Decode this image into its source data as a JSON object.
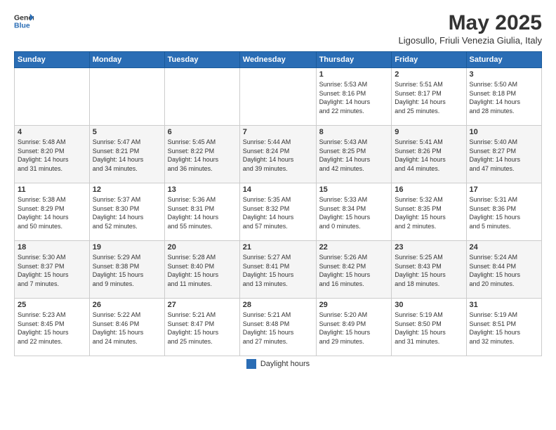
{
  "header": {
    "logo_general": "General",
    "logo_blue": "Blue",
    "month_title": "May 2025",
    "subtitle": "Ligosullo, Friuli Venezia Giulia, Italy"
  },
  "weekdays": [
    "Sunday",
    "Monday",
    "Tuesday",
    "Wednesday",
    "Thursday",
    "Friday",
    "Saturday"
  ],
  "footer": {
    "legend_label": "Daylight hours"
  },
  "weeks": [
    [
      {
        "day": "",
        "info": ""
      },
      {
        "day": "",
        "info": ""
      },
      {
        "day": "",
        "info": ""
      },
      {
        "day": "",
        "info": ""
      },
      {
        "day": "1",
        "info": "Sunrise: 5:53 AM\nSunset: 8:16 PM\nDaylight: 14 hours\nand 22 minutes."
      },
      {
        "day": "2",
        "info": "Sunrise: 5:51 AM\nSunset: 8:17 PM\nDaylight: 14 hours\nand 25 minutes."
      },
      {
        "day": "3",
        "info": "Sunrise: 5:50 AM\nSunset: 8:18 PM\nDaylight: 14 hours\nand 28 minutes."
      }
    ],
    [
      {
        "day": "4",
        "info": "Sunrise: 5:48 AM\nSunset: 8:20 PM\nDaylight: 14 hours\nand 31 minutes."
      },
      {
        "day": "5",
        "info": "Sunrise: 5:47 AM\nSunset: 8:21 PM\nDaylight: 14 hours\nand 34 minutes."
      },
      {
        "day": "6",
        "info": "Sunrise: 5:45 AM\nSunset: 8:22 PM\nDaylight: 14 hours\nand 36 minutes."
      },
      {
        "day": "7",
        "info": "Sunrise: 5:44 AM\nSunset: 8:24 PM\nDaylight: 14 hours\nand 39 minutes."
      },
      {
        "day": "8",
        "info": "Sunrise: 5:43 AM\nSunset: 8:25 PM\nDaylight: 14 hours\nand 42 minutes."
      },
      {
        "day": "9",
        "info": "Sunrise: 5:41 AM\nSunset: 8:26 PM\nDaylight: 14 hours\nand 44 minutes."
      },
      {
        "day": "10",
        "info": "Sunrise: 5:40 AM\nSunset: 8:27 PM\nDaylight: 14 hours\nand 47 minutes."
      }
    ],
    [
      {
        "day": "11",
        "info": "Sunrise: 5:38 AM\nSunset: 8:29 PM\nDaylight: 14 hours\nand 50 minutes."
      },
      {
        "day": "12",
        "info": "Sunrise: 5:37 AM\nSunset: 8:30 PM\nDaylight: 14 hours\nand 52 minutes."
      },
      {
        "day": "13",
        "info": "Sunrise: 5:36 AM\nSunset: 8:31 PM\nDaylight: 14 hours\nand 55 minutes."
      },
      {
        "day": "14",
        "info": "Sunrise: 5:35 AM\nSunset: 8:32 PM\nDaylight: 14 hours\nand 57 minutes."
      },
      {
        "day": "15",
        "info": "Sunrise: 5:33 AM\nSunset: 8:34 PM\nDaylight: 15 hours\nand 0 minutes."
      },
      {
        "day": "16",
        "info": "Sunrise: 5:32 AM\nSunset: 8:35 PM\nDaylight: 15 hours\nand 2 minutes."
      },
      {
        "day": "17",
        "info": "Sunrise: 5:31 AM\nSunset: 8:36 PM\nDaylight: 15 hours\nand 5 minutes."
      }
    ],
    [
      {
        "day": "18",
        "info": "Sunrise: 5:30 AM\nSunset: 8:37 PM\nDaylight: 15 hours\nand 7 minutes."
      },
      {
        "day": "19",
        "info": "Sunrise: 5:29 AM\nSunset: 8:38 PM\nDaylight: 15 hours\nand 9 minutes."
      },
      {
        "day": "20",
        "info": "Sunrise: 5:28 AM\nSunset: 8:40 PM\nDaylight: 15 hours\nand 11 minutes."
      },
      {
        "day": "21",
        "info": "Sunrise: 5:27 AM\nSunset: 8:41 PM\nDaylight: 15 hours\nand 13 minutes."
      },
      {
        "day": "22",
        "info": "Sunrise: 5:26 AM\nSunset: 8:42 PM\nDaylight: 15 hours\nand 16 minutes."
      },
      {
        "day": "23",
        "info": "Sunrise: 5:25 AM\nSunset: 8:43 PM\nDaylight: 15 hours\nand 18 minutes."
      },
      {
        "day": "24",
        "info": "Sunrise: 5:24 AM\nSunset: 8:44 PM\nDaylight: 15 hours\nand 20 minutes."
      }
    ],
    [
      {
        "day": "25",
        "info": "Sunrise: 5:23 AM\nSunset: 8:45 PM\nDaylight: 15 hours\nand 22 minutes."
      },
      {
        "day": "26",
        "info": "Sunrise: 5:22 AM\nSunset: 8:46 PM\nDaylight: 15 hours\nand 24 minutes."
      },
      {
        "day": "27",
        "info": "Sunrise: 5:21 AM\nSunset: 8:47 PM\nDaylight: 15 hours\nand 25 minutes."
      },
      {
        "day": "28",
        "info": "Sunrise: 5:21 AM\nSunset: 8:48 PM\nDaylight: 15 hours\nand 27 minutes."
      },
      {
        "day": "29",
        "info": "Sunrise: 5:20 AM\nSunset: 8:49 PM\nDaylight: 15 hours\nand 29 minutes."
      },
      {
        "day": "30",
        "info": "Sunrise: 5:19 AM\nSunset: 8:50 PM\nDaylight: 15 hours\nand 31 minutes."
      },
      {
        "day": "31",
        "info": "Sunrise: 5:19 AM\nSunset: 8:51 PM\nDaylight: 15 hours\nand 32 minutes."
      }
    ]
  ]
}
